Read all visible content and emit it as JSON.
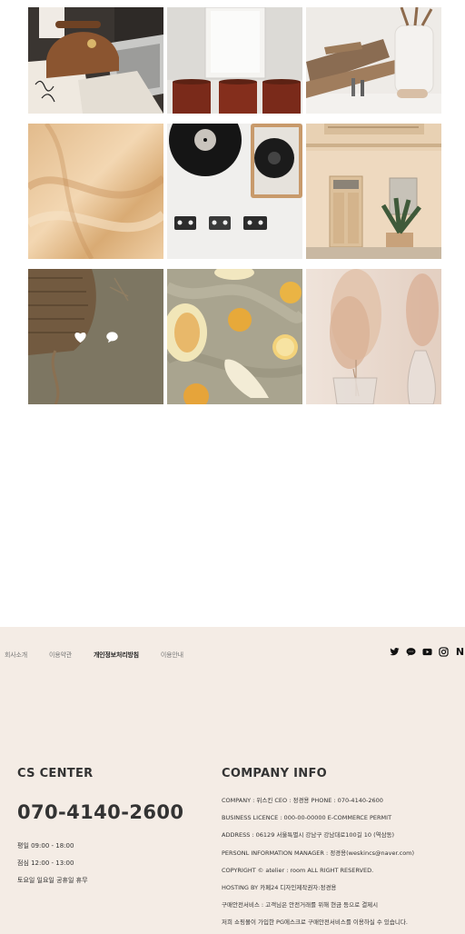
{
  "gallery": {
    "tiles": [
      {
        "name": "tile-handbag-desk",
        "overlay": false
      },
      {
        "name": "tile-frame-stools",
        "overlay": false
      },
      {
        "name": "tile-wood-boards",
        "overlay": false
      },
      {
        "name": "tile-silk-fabric",
        "overlay": false
      },
      {
        "name": "tile-turntable-cassettes",
        "overlay": false
      },
      {
        "name": "tile-building-door",
        "overlay": false
      },
      {
        "name": "tile-rattan-bag",
        "overlay": true
      },
      {
        "name": "tile-fruit-linen",
        "overlay": false
      },
      {
        "name": "tile-pampas-vase",
        "overlay": false
      }
    ],
    "overlay_icons": [
      "heart-icon",
      "comment-icon"
    ]
  },
  "footer": {
    "nav": [
      "회사소개",
      "이용약관",
      "개인정보처리방침",
      "이용안내"
    ],
    "nav_active_index": 2,
    "social_icons": [
      "twitter-icon",
      "kakaotalk-icon",
      "youtube-icon",
      "instagram-icon",
      "naver-icon"
    ],
    "naver_glyph": "N",
    "cs": {
      "title": "CS CENTER",
      "phone": "070-4140-2600",
      "hours": [
        "평일 09:00 - 18:00",
        "점심 12:00 - 13:00",
        "토요일 일요일 공휴일 휴무"
      ]
    },
    "company": {
      "title": "COMPANY INFO",
      "lines": [
        "COMPANY : 위스킨 CEO : 정경용 PHONE : 070-4140-2600",
        "BUSINESS LICENCE : 000-00-00000 E-COMMERCE PERMIT",
        "ADDRESS : 06129 서울특별시 강남구 강남대로100길 10 (역삼동)",
        "PERSONL INFORMATION MANAGER : 정경용(weskincs@naver.com)",
        "COPYRIGHT © atelier : room ALL RIGHT RESERVED.",
        "HOSTING BY 카페24 디자인제작권자:정경용",
        "구매안전서비스 : 고객님은 안전거래를 위해 현금 등으로 결제시",
        "저희 쇼핑몰이 가입한 PG에스크로 구매안전서비스를 이용하실 수 있습니다."
      ]
    },
    "colors": {
      "background": "#f4ece5",
      "text": "#333333"
    }
  }
}
